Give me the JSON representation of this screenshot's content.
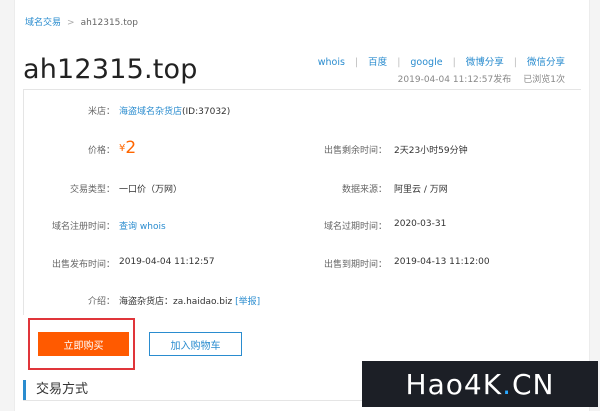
{
  "breadcrumb": {
    "parent": "域名交易",
    "separator": ">",
    "current": "ah12315.top"
  },
  "domain_title": "ah12315.top",
  "share_links": [
    "whois",
    "百度",
    "google",
    "微博分享",
    "微信分享"
  ],
  "meta": {
    "published": "2019-04-04 11:12:57发布",
    "views": "已浏览1次"
  },
  "details": {
    "shop_label": "米店：",
    "shop_name": "海盗域名杂货店",
    "shop_id": "(ID:37032)",
    "price_label": "价格：",
    "price_currency": "¥",
    "price_value": "2",
    "remaining_label": "出售剩余时间：",
    "remaining_value": "2天23小时59分钟",
    "trade_type_label": "交易类型：",
    "trade_type_value": "一口价（万网）",
    "source_label": "数据来源：",
    "source_value": "阿里云 / 万网",
    "reg_time_label": "域名注册时间：",
    "reg_time_link1": "查询",
    "reg_time_link2": "whois",
    "expire_label": "域名过期时间：",
    "expire_value": "2020-03-31",
    "publish_label": "出售发布时间：",
    "publish_value": "2019-04-04 11:12:57",
    "end_label": "出售到期时间：",
    "end_value": "2019-04-13 11:12:00",
    "intro_label": "介绍：",
    "intro_value": "海盗杂货店：za.haidao.biz",
    "report_link": "[举报]"
  },
  "actions": {
    "buy_label": "立即购买",
    "cart_label": "加入购物车"
  },
  "section": {
    "title": "交易方式"
  },
  "watermark": {
    "main": "Hao4K",
    "dot": ".",
    "suffix": "CN"
  },
  "colors": {
    "accent": "#2a8ccf",
    "buy": "#ff5a00",
    "highlight": "#e0353a"
  }
}
